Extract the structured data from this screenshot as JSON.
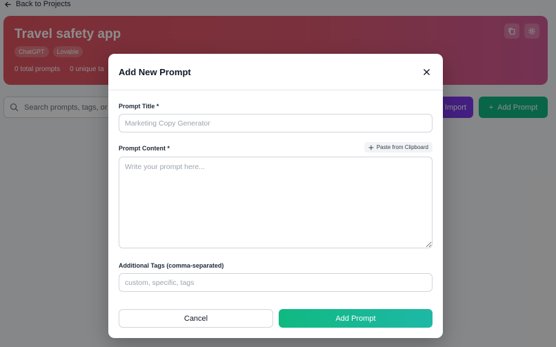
{
  "nav": {
    "back_label": "Back to Projects"
  },
  "project": {
    "title": "Travel safety app",
    "tags": [
      "ChatGPT",
      "Lovable"
    ],
    "stats": {
      "total_prompts": "0 total prompts",
      "unique_tags": "0 unique ta"
    }
  },
  "toolbar": {
    "search_placeholder": "Search prompts, tags, or co",
    "import_label": "Import",
    "add_label": "Add Prompt"
  },
  "modal": {
    "title": "Add New Prompt",
    "title_field": {
      "label": "Prompt Title *",
      "placeholder": "Marketing Copy Generator"
    },
    "content_field": {
      "label": "Prompt Content *",
      "placeholder": "Write your prompt here...",
      "paste_label": "Paste from Clipboard"
    },
    "tags_field": {
      "label": "Additional Tags (comma-separated)",
      "placeholder": "custom, specific, tags"
    },
    "cancel_label": "Cancel",
    "submit_label": "Add Prompt"
  },
  "colors": {
    "accent_green": "#10b981",
    "accent_purple": "#7c3aed",
    "hero_gradient_start": "#e25561",
    "hero_gradient_end": "#d45c98"
  }
}
